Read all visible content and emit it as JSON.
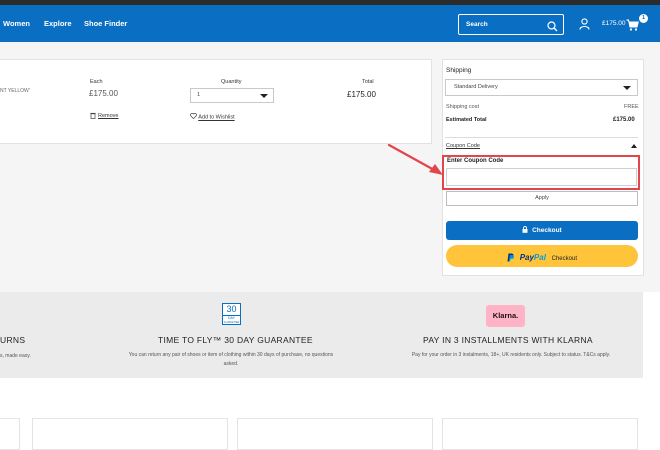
{
  "nav": {
    "links": [
      "Women",
      "Explore",
      "Shoe Finder"
    ],
    "search_placeholder": "Search",
    "cart_total": "£175.00",
    "cart_count": "1"
  },
  "cart": {
    "columns": {
      "each": "Each",
      "quantity": "Quantity",
      "total": "Total"
    },
    "item": {
      "name_fragment": "NT YELLOW'",
      "each_price": "£175.00",
      "quantity": "1",
      "total": "£175.00",
      "remove_label": "Remove",
      "wishlist_label": "Add to Wishlist"
    }
  },
  "summary": {
    "shipping_heading": "Shipping",
    "shipping_option": "Standard Delivery",
    "shipping_cost_label": "Shipping cost",
    "shipping_cost_value": "FREE",
    "estimated_total_label": "Estimated Total",
    "estimated_total_value": "£175.00",
    "coupon_toggle_label": "Coupon Code",
    "coupon_field_label": "Enter Coupon Code",
    "apply_label": "Apply",
    "checkout_label": "Checkout",
    "paypal_pay": "Pay",
    "paypal_pal": "Pal",
    "paypal_suffix": "Checkout"
  },
  "benefits": {
    "returns_title": "URNS",
    "returns_text": "s, made easy.",
    "guarantee_badge_number": "30",
    "guarantee_badge_day": "DAY",
    "guarantee_badge_sub": "GUARANTEE",
    "guarantee_title": "TIME TO FLY™ 30 DAY GUARANTEE",
    "guarantee_text_1": "You can return any pair of shoes or item of clothing within 30 days of purchase, no questions",
    "guarantee_text_2": "asked.",
    "klarna_logo": "Klarna.",
    "klarna_title": "PAY IN 3 INSTALLMENTS WITH KLARNA",
    "klarna_text": "Pay for your order in 3 instalments, 18+, UK residents only. Subject to status. T&Cs apply."
  },
  "colors": {
    "brand_blue": "#0a6fc2",
    "highlight_red": "#e2454b",
    "paypal_yellow": "#ffc439",
    "klarna_pink": "#ffb3c7"
  }
}
